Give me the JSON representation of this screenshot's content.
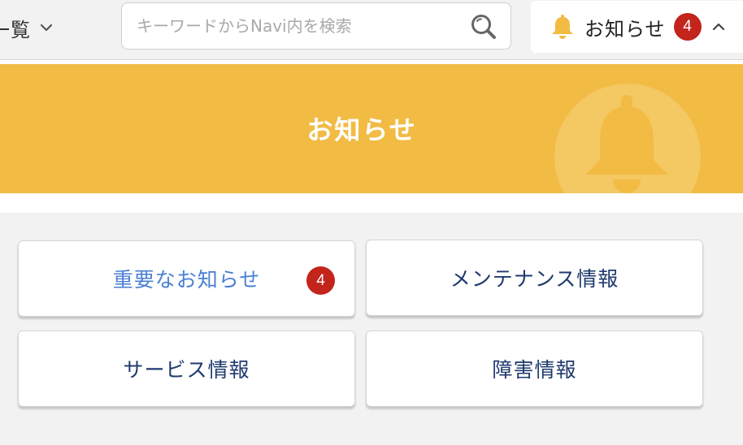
{
  "header": {
    "menu_label": "一覧",
    "search": {
      "placeholder": "キーワードからNavi内を検索",
      "value": ""
    },
    "notice": {
      "label": "お知らせ",
      "count": "4"
    }
  },
  "banner": {
    "title": "お知らせ"
  },
  "categories": [
    {
      "label": "重要なお知らせ",
      "count": "4"
    },
    {
      "label": "メンテナンス情報"
    },
    {
      "label": "サービス情報"
    },
    {
      "label": "障害情報"
    }
  ],
  "colors": {
    "banner": "#f1bb44",
    "badge": "#c3241c",
    "important_text": "#4a7fd4",
    "category_text": "#1f3a6e"
  },
  "icons": {
    "menu_chevron": "chevron-down-icon",
    "search": "search-icon",
    "notice_bell": "bell-icon",
    "notice_caret": "chevron-up-icon",
    "banner_bell": "bell-icon"
  }
}
